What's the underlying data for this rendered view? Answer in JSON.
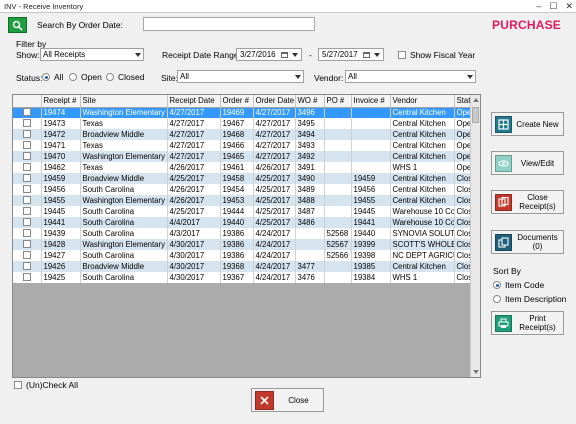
{
  "window": {
    "title": "INV - Receive Inventory",
    "minimize": "–",
    "maximize": "☐",
    "close": "✕"
  },
  "header": {
    "search_label": "Search By Order Date:",
    "search_value": "",
    "heading": "PURCHASE"
  },
  "filter": {
    "title": "Filter by",
    "show_label": "Show:",
    "show_value": "All Receipts",
    "date_range_label": "Receipt Date Range:",
    "date_from": "3/27/2016",
    "date_sep": "-",
    "date_to": "5/27/2017",
    "fiscal_label": "Show Fiscal Year",
    "status_label": "Status:",
    "status_options": [
      "All",
      "Open",
      "Closed"
    ],
    "status_selected": "All",
    "site_label": "Site:",
    "site_value": "All",
    "vendor_label": "Vendor:",
    "vendor_value": "All"
  },
  "table": {
    "columns": [
      "",
      "Receipt #",
      "Site",
      "Receipt Date",
      "Order #",
      "Order Date",
      "WO #",
      "PO #",
      "Invoice #",
      "Vendor",
      "Statu"
    ],
    "rows": [
      [
        "19474",
        "Washington Elementary",
        "4/27/2017",
        "19469",
        "4/27/2017",
        "3496",
        "",
        "",
        "Central Kitchen",
        "Ope"
      ],
      [
        "19473",
        "Texas",
        "4/27/2017",
        "19467",
        "4/27/2017",
        "3495",
        "",
        "",
        "Central Kitchen",
        "Ope"
      ],
      [
        "19472",
        "Broadview Middle",
        "4/27/2017",
        "19468",
        "4/27/2017",
        "3494",
        "",
        "",
        "Central Kitchen",
        "Ope"
      ],
      [
        "19471",
        "Texas",
        "4/27/2017",
        "19466",
        "4/27/2017",
        "3493",
        "",
        "",
        "Central Kitchen",
        "Ope"
      ],
      [
        "19470",
        "Washington Elementary",
        "4/27/2017",
        "19465",
        "4/27/2017",
        "3492",
        "",
        "",
        "Central Kitchen",
        "Ope"
      ],
      [
        "19462",
        "Texas",
        "4/26/2017",
        "19461",
        "4/26/2017",
        "3491",
        "",
        "",
        "WHS 1",
        "Ope"
      ],
      [
        "19459",
        "Broadview Middle",
        "4/25/2017",
        "19458",
        "4/25/2017",
        "3490",
        "",
        "19459",
        "Central Kitchen",
        "Clos"
      ],
      [
        "19456",
        "South Carolina",
        "4/26/2017",
        "19454",
        "4/25/2017",
        "3489",
        "",
        "19456",
        "Central Kitchen",
        "Clos"
      ],
      [
        "19455",
        "Washington Elementary",
        "4/26/2017",
        "19453",
        "4/25/2017",
        "3488",
        "",
        "19455",
        "Central Kitchen",
        "Clos"
      ],
      [
        "19445",
        "South Carolina",
        "4/25/2017",
        "19444",
        "4/25/2017",
        "3487",
        "",
        "19445",
        "Warehouse 10 Co",
        "Clos"
      ],
      [
        "19441",
        "South Carolina",
        "4/4/2017",
        "19440",
        "4/25/2017",
        "3486",
        "",
        "19441",
        "Warehouse 10 Co",
        "Clos"
      ],
      [
        "19439",
        "South Carolina",
        "4/3/2017",
        "19386",
        "4/24/2017",
        "",
        "52568",
        "19440",
        "SYNOVIA SOLUTI",
        "Clos"
      ],
      [
        "19428",
        "Washington Elementary",
        "4/30/2017",
        "19386",
        "4/24/2017",
        "",
        "52567",
        "19399",
        "SCOTT'S WHOLES",
        "Clos"
      ],
      [
        "19427",
        "South Carolina",
        "4/30/2017",
        "19386",
        "4/24/2017",
        "",
        "52566",
        "19398",
        "NC DEPT AGRICU",
        "Clos"
      ],
      [
        "19426",
        "Broadview Middle",
        "4/30/2017",
        "19368",
        "4/24/2017",
        "3477",
        "",
        "19385",
        "Central Kitchen",
        "Clos"
      ],
      [
        "19425",
        "South Carolina",
        "4/30/2017",
        "19367",
        "4/24/2017",
        "3476",
        "",
        "19384",
        "WHS 1",
        "Clos"
      ]
    ]
  },
  "footer": {
    "check_all_label": "(Un)Check All",
    "close_label": "Close"
  },
  "actions": {
    "create_new": "Create New",
    "view_edit": "View/Edit",
    "close_receipts": "Close Receipt(s)",
    "documents": "Documents (0)",
    "sort_by_label": "Sort By",
    "sort_options": [
      "Item Code",
      "Item Description"
    ],
    "sort_selected": "Item Code",
    "print_receipts": "Print Receipt(s)"
  },
  "colors": {
    "heading": "#e0195a",
    "selected_row": "#3399ff",
    "alt_row": "#d6e4f0",
    "icon_teal": "#1f7a8c",
    "icon_red": "#c0392b",
    "search_green": "#1f9e3f"
  }
}
